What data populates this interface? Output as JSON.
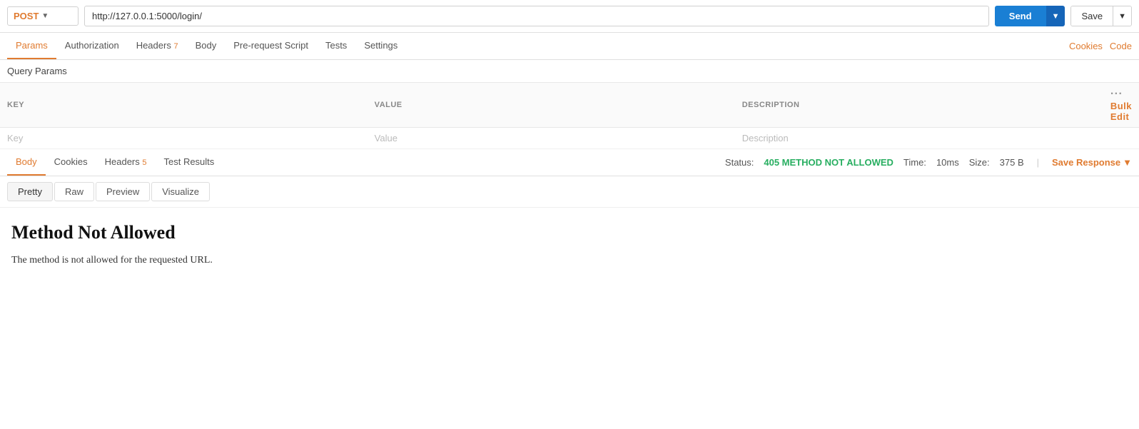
{
  "topbar": {
    "method": "POST",
    "method_arrow": "▼",
    "url": "http://127.0.0.1:5000/login/",
    "send_label": "Send",
    "send_dropdown_arrow": "▼",
    "save_label": "Save",
    "save_dropdown_arrow": "▼"
  },
  "request_tabs": [
    {
      "id": "params",
      "label": "Params",
      "active": true
    },
    {
      "id": "authorization",
      "label": "Authorization",
      "active": false
    },
    {
      "id": "headers",
      "label": "Headers",
      "badge": "7",
      "active": false
    },
    {
      "id": "body",
      "label": "Body",
      "active": false
    },
    {
      "id": "prerequest",
      "label": "Pre-request Script",
      "active": false
    },
    {
      "id": "tests",
      "label": "Tests",
      "active": false
    },
    {
      "id": "settings",
      "label": "Settings",
      "active": false
    }
  ],
  "right_links": [
    {
      "id": "cookies",
      "label": "Cookies"
    },
    {
      "id": "code",
      "label": "Code"
    }
  ],
  "query_params": {
    "section_label": "Query Params",
    "columns": [
      {
        "id": "key",
        "label": "KEY"
      },
      {
        "id": "value",
        "label": "VALUE"
      },
      {
        "id": "description",
        "label": "DESCRIPTION"
      }
    ],
    "placeholder_row": {
      "key": "Key",
      "value": "Value",
      "description": "Description"
    },
    "bulk_edit_label": "Bulk Edit",
    "dots": "···"
  },
  "response_tabs": [
    {
      "id": "body",
      "label": "Body",
      "active": true
    },
    {
      "id": "cookies",
      "label": "Cookies",
      "active": false
    },
    {
      "id": "headers",
      "label": "Headers",
      "badge": "5",
      "active": false
    },
    {
      "id": "test_results",
      "label": "Test Results",
      "active": false
    }
  ],
  "status_bar": {
    "status_label": "Status:",
    "status_value": "405 METHOD NOT ALLOWED",
    "time_label": "Time:",
    "time_value": "10ms",
    "size_label": "Size:",
    "size_value": "375 B",
    "save_response_label": "Save Response",
    "save_response_arrow": "▼"
  },
  "view_tabs": [
    {
      "id": "pretty",
      "label": "Pretty",
      "active": true
    },
    {
      "id": "raw",
      "label": "Raw",
      "active": false
    },
    {
      "id": "preview",
      "label": "Preview",
      "active": false
    },
    {
      "id": "visualize",
      "label": "Visualize",
      "active": false
    }
  ],
  "response_body": {
    "heading": "Method Not Allowed",
    "message": "The method is not allowed for the requested URL."
  }
}
